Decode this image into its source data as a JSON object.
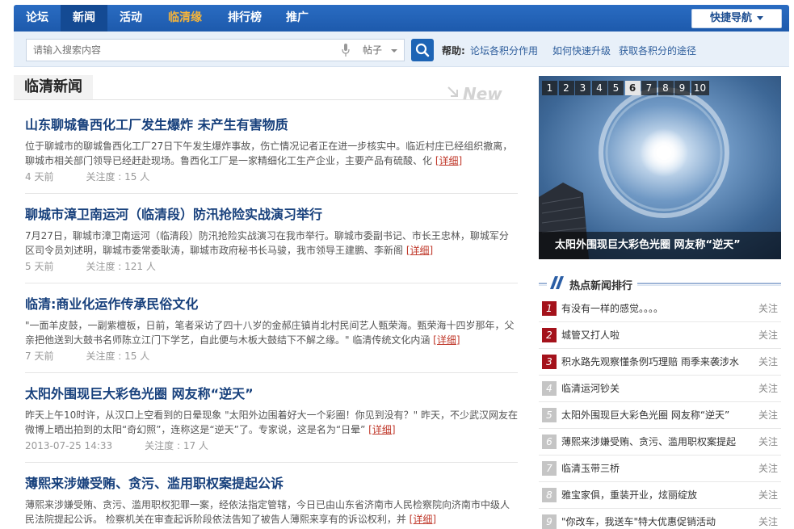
{
  "nav": {
    "items": [
      {
        "label": "论坛"
      },
      {
        "label": "新闻"
      },
      {
        "label": "活动"
      },
      {
        "label": "临清缘"
      },
      {
        "label": "排行榜"
      },
      {
        "label": "推广"
      }
    ],
    "active_index": 1,
    "quick_nav_label": "快捷导航"
  },
  "search": {
    "placeholder": "请输入搜索内容",
    "type_selected": "帖子",
    "help_label": "帮助:",
    "help_links": [
      "论坛各积分作用",
      "如何快速升级",
      "获取各积分的途径"
    ]
  },
  "section": {
    "title": "临清新闻",
    "new_mark": "New"
  },
  "articles": [
    {
      "title": "山东聊城鲁西化工厂发生爆炸 未产生有害物质",
      "summary": "位于聊城市的聊城鲁西化工厂27日下午发生爆炸事故，伤亡情况记者正在进一步核实中。临近村庄已经组织撤离，聊城市相关部门领导已经赶赴现场。鲁西化工厂是一家精细化工生产企业，主要产品有硫酸、化",
      "detail": "[详细]",
      "time": "4 天前",
      "attention": "关注度 : 15 人"
    },
    {
      "title": "聊城市漳卫南运河（临清段）防汛抢险实战演习举行",
      "summary": "7月27日，聊城市漳卫南运河（临清段）防汛抢险实战演习在我市举行。聊城市委副书记、市长王忠林，聊城军分区司令员刘述明，聊城市委常委耿涛，聊城市政府秘书长马骏，我市领导王建鹏、李新阁",
      "detail": "[详细]",
      "time": "5 天前",
      "attention": "关注度 : 121 人"
    },
    {
      "title": "临清:商业化运作传承民俗文化",
      "summary": "\"一面羊皮鼓，一副紫檀板，日前，笔者采访了四十八岁的金郝庄镇肖北村民间艺人甄荣海。甄荣海十四岁那年，父亲把他送到大鼓书名师陈立江门下学艺，自此便与木板大鼓结下不解之缘。\"      临清传统文化内涵",
      "detail": "[详细]",
      "time": "7 天前",
      "attention": "关注度 : 15 人"
    },
    {
      "title": "太阳外围现巨大彩色光圈 网友称“逆天”",
      "summary": "昨天上午10时许，从汉口上空看到的日晕现象  \"太阳外边围着好大一个彩圈！你见到没有？\"  昨天，不少武汉网友在微博上晒出拍到的太阳“奇幻照”，连称这是“逆天”了。专家说，这是名为“日晕”",
      "detail": "[详细]",
      "time": "2013-07-25 14:33",
      "attention": "关注度 : 17 人"
    },
    {
      "title": "薄熙来涉嫌受贿、贪污、滥用职权案提起公诉",
      "summary": "薄熙来涉嫌受贿、贪污、滥用职权犯罪一案，经依法指定管辖，今日已由山东省济南市人民检察院向济南市中级人民法院提起公诉。 检察机关在审查起诉阶段依法告知了被告人薄熙来享有的诉讼权利，并",
      "detail": "[详细]",
      "time": "",
      "attention": ""
    }
  ],
  "slideshow": {
    "numbers": [
      "1",
      "2",
      "3",
      "4",
      "5",
      "6",
      "7",
      "8",
      "9",
      "10"
    ],
    "active_index": 5,
    "caption": "太阳外围现巨大彩色光圈 网友称“逆天”"
  },
  "hot": {
    "title": "热点新闻排行",
    "follow_label": "关注",
    "items": [
      {
        "rank": "1",
        "text": "有没有一样的感觉。。。。"
      },
      {
        "rank": "2",
        "text": "城管又打人啦"
      },
      {
        "rank": "3",
        "text": "积水路先观察懂条例巧理赔 雨季来袭涉水"
      },
      {
        "rank": "4",
        "text": "临清运河钞关"
      },
      {
        "rank": "5",
        "text": "太阳外围现巨大彩色光圈 网友称“逆天”"
      },
      {
        "rank": "6",
        "text": "薄熙来涉嫌受贿、贪污、滥用职权案提起"
      },
      {
        "rank": "7",
        "text": "临清玉带三桥"
      },
      {
        "rank": "8",
        "text": "雅宝家俱，重装开业，炫丽绽放"
      },
      {
        "rank": "9",
        "text": "\"你改车，我送车\"特大优惠促销活动"
      }
    ]
  },
  "colors": {
    "nav_bg": "#1d5aac",
    "highlight": "#f7b53a",
    "title_blue": "#17407c",
    "rank_top": "#a4121b",
    "detail_red": "#c0392b"
  }
}
